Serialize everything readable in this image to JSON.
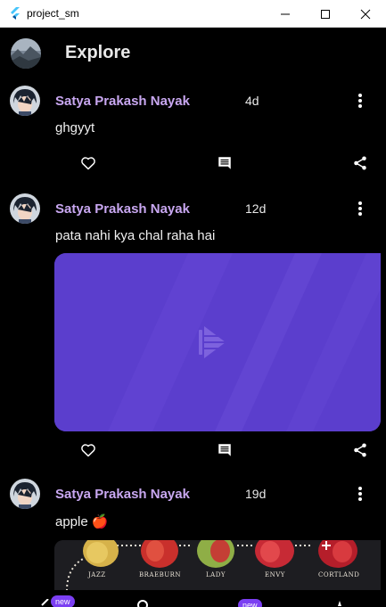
{
  "window": {
    "title": "project_sm",
    "app_icon": "flutter-icon"
  },
  "appbar": {
    "title": "Explore",
    "avatar_icon": "profile-avatar"
  },
  "posts": [
    {
      "author": "Satya Prakash Nayak",
      "time": "4d",
      "text": "ghgyyt",
      "media": "none"
    },
    {
      "author": "Satya Prakash Nayak",
      "time": "12d",
      "text": "pata nahi kya chal raha hai",
      "media": "image-placeholder"
    },
    {
      "author": "Satya Prakash Nayak",
      "time": "19d",
      "text": "apple 🍎",
      "media": "apple-varieties-photo",
      "media_labels": [
        "JAZZ",
        "BRAEBURN",
        "LADY",
        "ENVY",
        "CORTLAND"
      ]
    }
  ],
  "actions": {
    "like_icon": "heart-icon",
    "comment_icon": "comment-icon",
    "share_icon": "share-icon",
    "menu_icon": "more-vert-icon"
  },
  "bottom_nav": {
    "badges": [
      "new",
      "new"
    ]
  },
  "colors": {
    "background": "#000000",
    "author": "#c8a7f0",
    "media_purple": "#5e40cf",
    "badge": "#7b3ff2"
  }
}
